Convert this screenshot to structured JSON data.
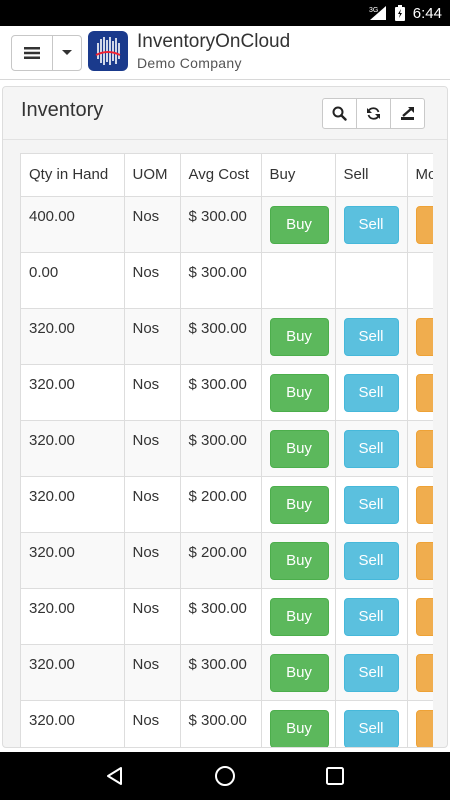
{
  "statusbar": {
    "network": "3G",
    "time": "6:44"
  },
  "app": {
    "title": "InventoryOnCloud",
    "subtitle": "Demo Company"
  },
  "panel": {
    "title": "Inventory"
  },
  "toolbar": {
    "icons": [
      "search-icon",
      "refresh-icon",
      "export-icon"
    ]
  },
  "table": {
    "headers": [
      "Qty in Hand",
      "UOM",
      "Avg Cost",
      "Buy",
      "Sell",
      "Mo"
    ],
    "buy_label": "Buy",
    "sell_label": "Sell",
    "rows": [
      {
        "qty": "400.00",
        "uom": "Nos",
        "cost": "$ 300.00",
        "actions": true
      },
      {
        "qty": "0.00",
        "uom": "Nos",
        "cost": "$ 300.00",
        "actions": false
      },
      {
        "qty": "320.00",
        "uom": "Nos",
        "cost": "$ 300.00",
        "actions": true
      },
      {
        "qty": "320.00",
        "uom": "Nos",
        "cost": "$ 300.00",
        "actions": true
      },
      {
        "qty": "320.00",
        "uom": "Nos",
        "cost": "$ 300.00",
        "actions": true
      },
      {
        "qty": "320.00",
        "uom": "Nos",
        "cost": "$ 200.00",
        "actions": true
      },
      {
        "qty": "320.00",
        "uom": "Nos",
        "cost": "$ 200.00",
        "actions": true
      },
      {
        "qty": "320.00",
        "uom": "Nos",
        "cost": "$ 300.00",
        "actions": true
      },
      {
        "qty": "320.00",
        "uom": "Nos",
        "cost": "$ 300.00",
        "actions": true
      },
      {
        "qty": "320.00",
        "uom": "Nos",
        "cost": "$ 300.00",
        "actions": true
      }
    ]
  },
  "colors": {
    "buy": "#5cb85c",
    "sell": "#5bc0de",
    "move": "#f0ad4e",
    "logo": "#1a3a8c"
  },
  "navbar": {
    "icons": [
      "back-icon",
      "home-icon",
      "recents-icon"
    ]
  }
}
